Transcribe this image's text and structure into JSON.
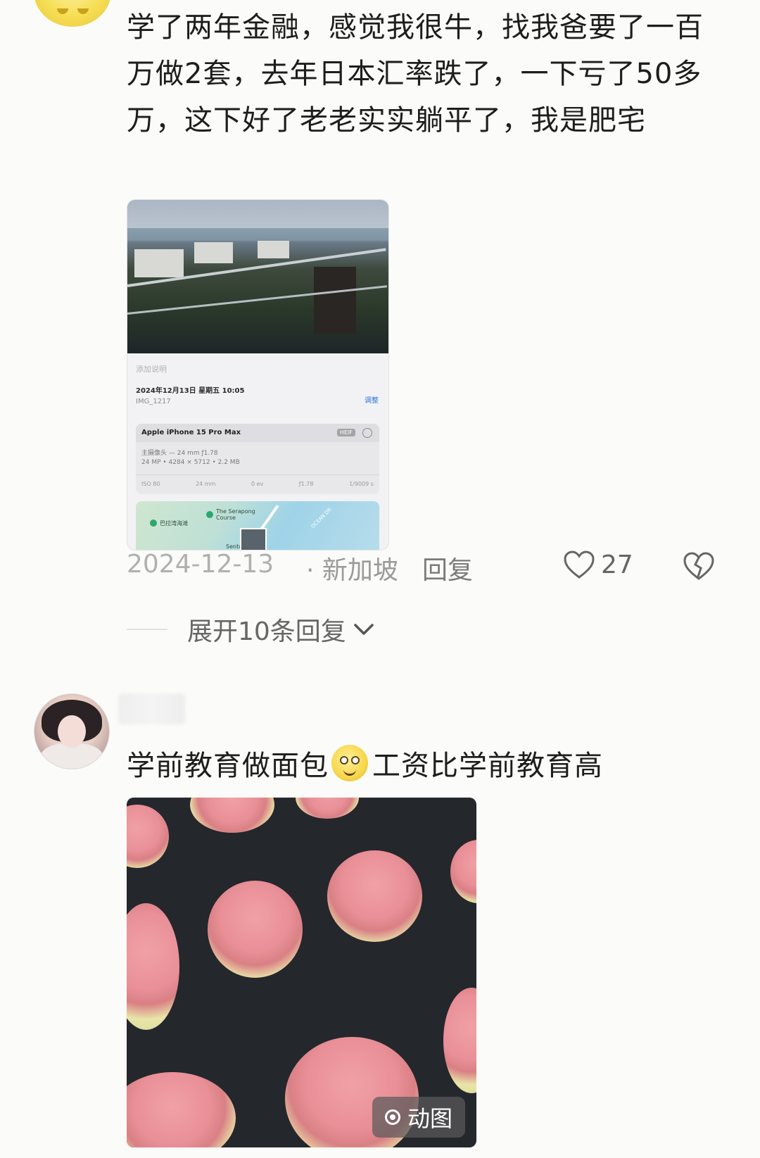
{
  "comments": [
    {
      "text": "学了两年金融，感觉我很牛，找我爸要了一百万做2套，去年日本汇率跌了，一下亏了50多万，这下好了老老实实躺平了，我是肥宅",
      "screenshot": {
        "caption_placeholder": "添加说明",
        "date_line": "2024年12月13日 星期五 10:05",
        "file_name": "IMG_1217",
        "adjust_label": "调整",
        "device": "Apple iPhone 15 Pro Max",
        "format_badge": "HEIF",
        "lens": "主摄像头 — 24 mm ƒ1.78",
        "resolution": "24 MP • 4284 × 5712 • 2.2 MB",
        "specs": [
          "ISO 80",
          "24 mm",
          "0 ev",
          "ƒ1.78",
          "1/9009 s"
        ],
        "map_labels": [
          "The Serapong Course",
          "巴拉湾海滩",
          "OCEAN DR",
          "Sentosa"
        ]
      },
      "date": "2024-12-13",
      "location": "· 新加坡",
      "reply_label": "回复",
      "likes": "27",
      "expand_label": "展开10条回复"
    },
    {
      "text_before": "学前教育做面包",
      "text_after": "工资比学前教育高",
      "media_badge": "动图"
    }
  ],
  "icons": [
    "heart-icon",
    "broken-heart-icon",
    "chevron-down-icon",
    "smile-emoji-icon",
    "live-photo-icon"
  ]
}
